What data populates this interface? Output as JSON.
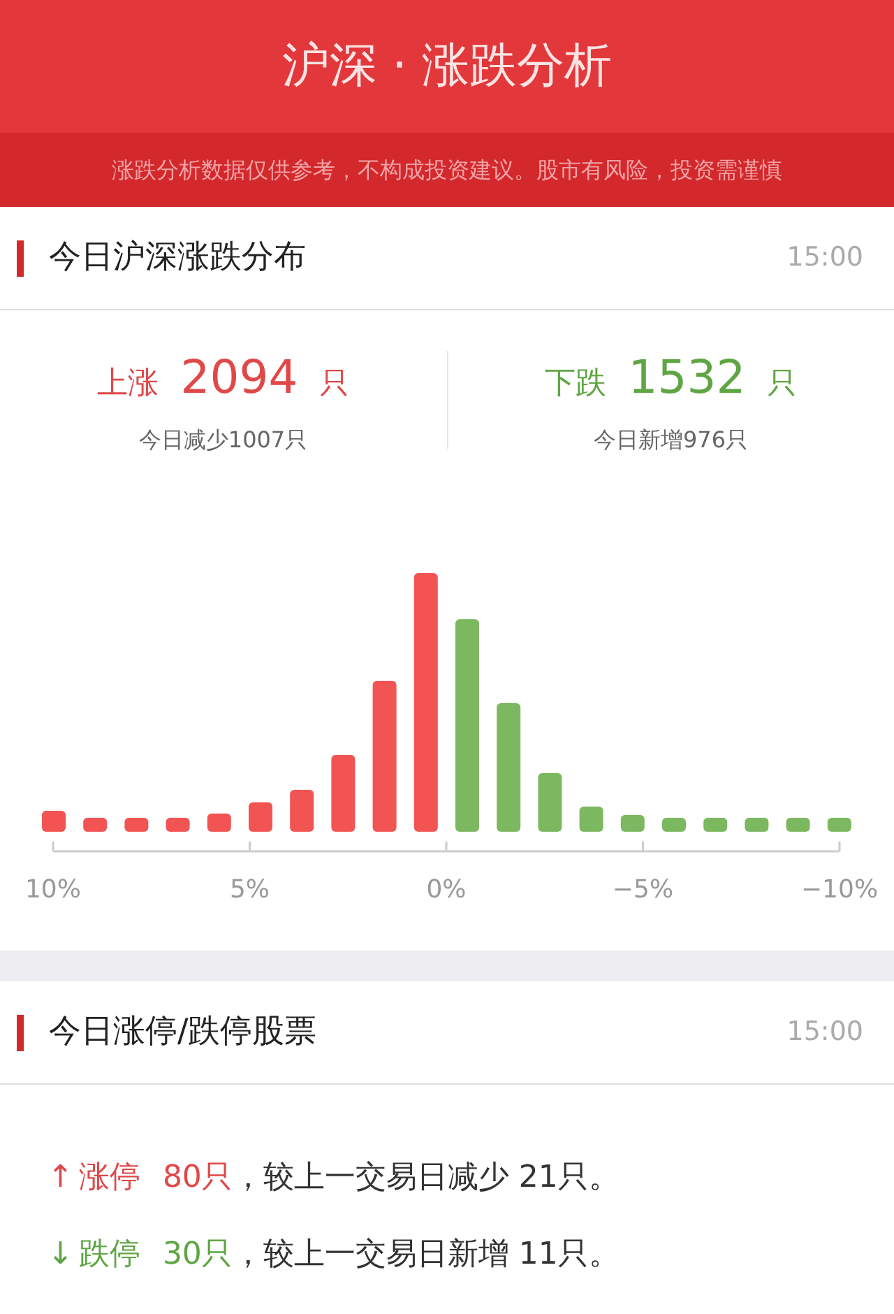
{
  "header": {
    "title": "沪深 · 涨跌分析",
    "disclaimer": "涨跌分析数据仅供参考，不构成投资建议。股市有风险，投资需谨慎"
  },
  "distribution": {
    "title": "今日沪深涨跌分布",
    "time": "15:00",
    "stats": [
      {
        "kind": "up",
        "label": "上涨",
        "count": "2094",
        "unit": "只",
        "change": "今日减少1007只"
      },
      {
        "kind": "down",
        "label": "下跌",
        "count": "1532",
        "unit": "只",
        "change": "今日新增976只"
      }
    ],
    "axis_labels": [
      "10%",
      "5%",
      "0%",
      "−5%",
      "−10%"
    ]
  },
  "limits": {
    "title": "今日涨停/跌停股票",
    "time": "15:00",
    "lines": [
      {
        "kind": "up",
        "arrow": "↑",
        "label": "涨停",
        "count": "80只",
        "text": "，较上一交易日减少 21只。"
      },
      {
        "kind": "down",
        "arrow": "↓",
        "label": "跌停",
        "count": "30只",
        "text": "，较上一交易日新增 11只。"
      }
    ]
  }
}
